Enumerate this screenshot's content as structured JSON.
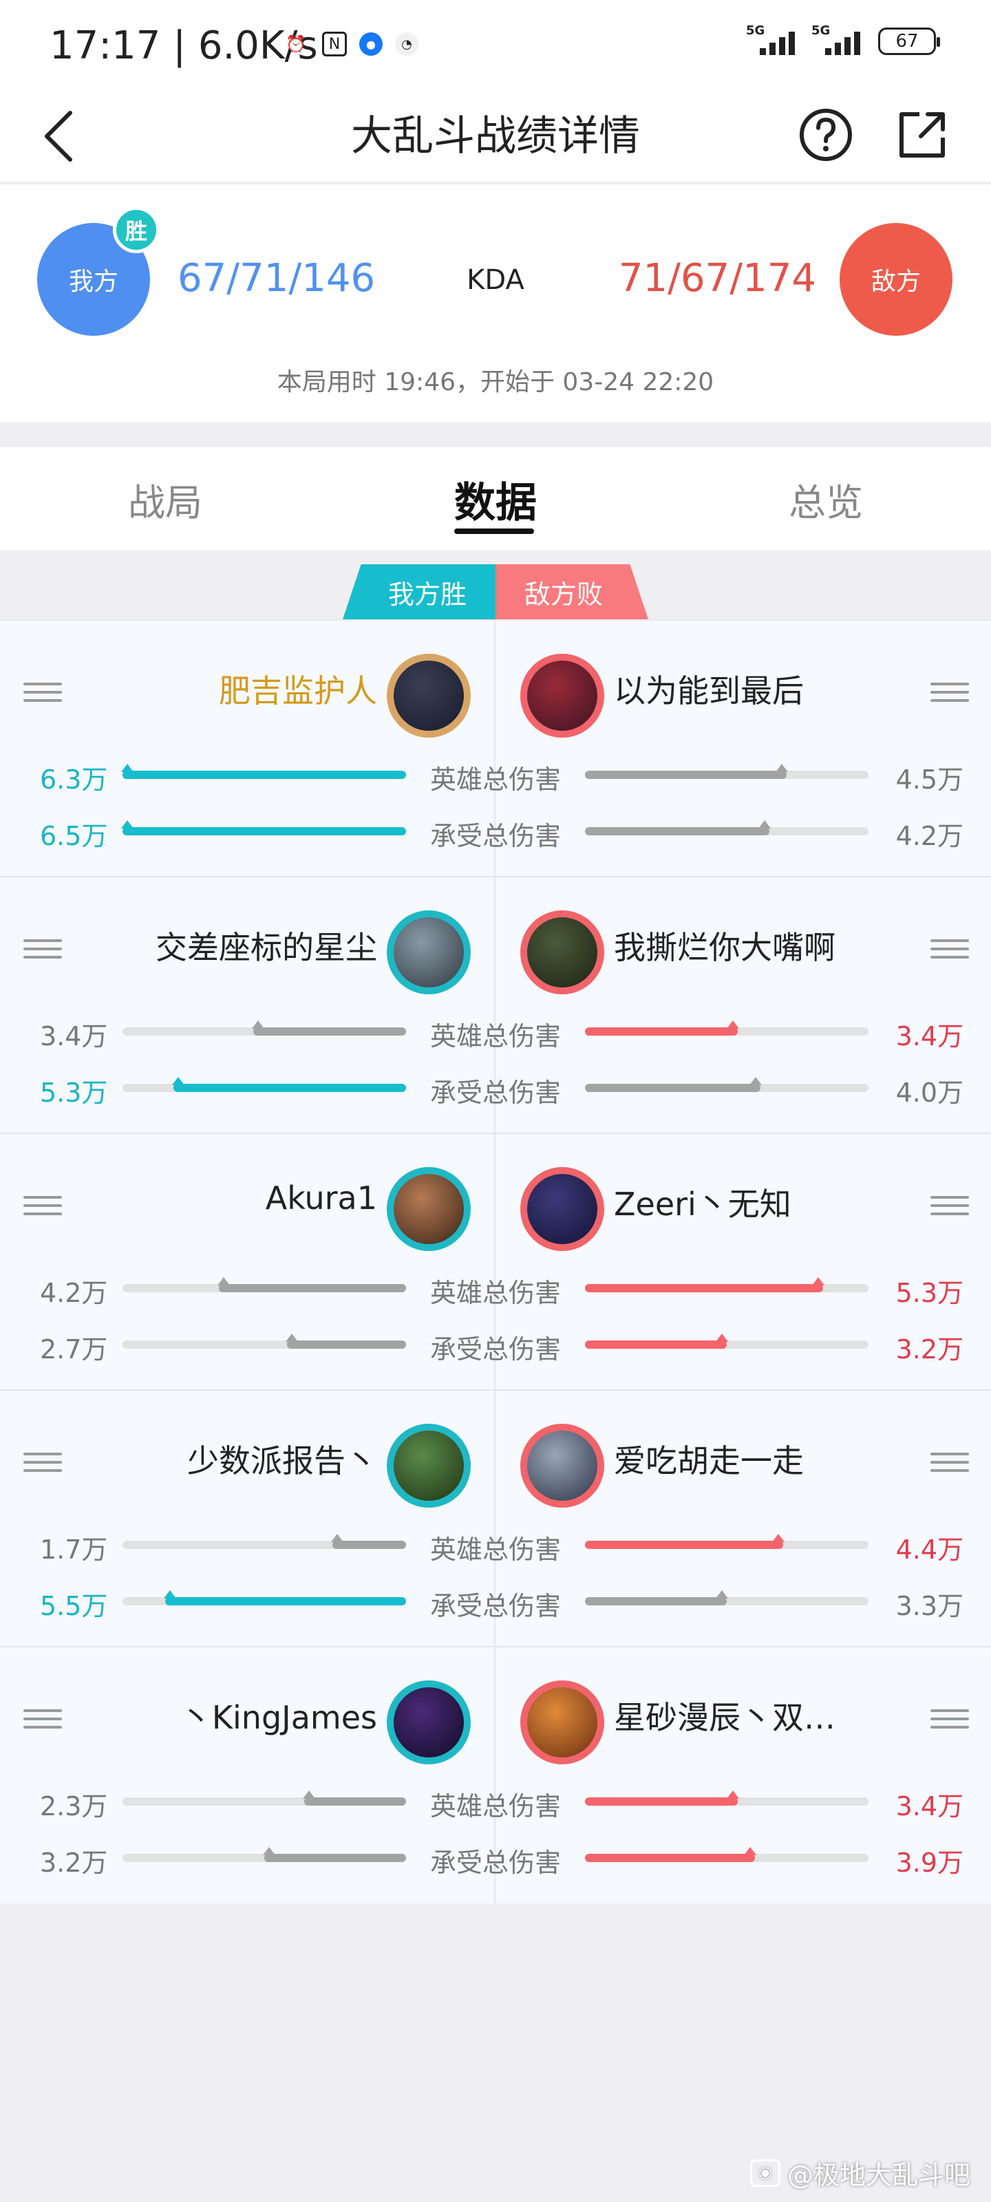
{
  "status": {
    "time": "17:17",
    "speed": "6.0K/s",
    "network1": "5G",
    "network2": "5G",
    "battery": "67"
  },
  "header": {
    "title": "大乱斗战绩详情"
  },
  "summary": {
    "left_team": "我方",
    "right_team": "敌方",
    "win_badge": "胜",
    "left_kda": "67/71/146",
    "right_kda": "71/67/174",
    "kda_label": "KDA",
    "time_info": "本局用时 19:46，开始于 03-24 22:20"
  },
  "tabs": [
    "战局",
    "数据",
    "总览"
  ],
  "active_tab": 1,
  "banner": {
    "left": "我方胜",
    "right": "敌方败"
  },
  "stat_labels": {
    "damage": "英雄总伤害",
    "taken": "承受总伤害"
  },
  "colors": {
    "teal": "#17bdcc",
    "gray": "#a3a3a3",
    "red": "#f4646c",
    "gold": "#d39a1c"
  },
  "players": [
    {
      "left": {
        "name": "肥吉监护人",
        "avatar": "dark-hero",
        "damage": "6.3万",
        "damage_fill": 1.0,
        "damage_style": "teal",
        "taken": "6.5万",
        "taken_fill": 1.0,
        "taken_style": "teal",
        "highlight": true
      },
      "right": {
        "name": "以为能到最后",
        "avatar": "red-haired-hero",
        "damage": "4.5万",
        "damage_fill": 0.71,
        "damage_style": "gray",
        "taken": "4.2万",
        "taken_fill": 0.65,
        "taken_style": "gray"
      }
    },
    {
      "left": {
        "name": "交差座标的星尘",
        "avatar": "armored-warrior",
        "damage": "3.4万",
        "damage_fill": 0.54,
        "damage_style": "gray",
        "taken": "5.3万",
        "taken_fill": 0.82,
        "taken_style": "teal"
      },
      "right": {
        "name": "我撕烂你大嘴啊",
        "avatar": "green-hooded-hero",
        "damage": "3.4万",
        "damage_fill": 0.54,
        "damage_style": "red",
        "taken": "4.0万",
        "taken_fill": 0.62,
        "taken_style": "gray"
      }
    },
    {
      "left": {
        "name": "Akura1",
        "avatar": "male-fighter",
        "damage": "4.2万",
        "damage_fill": 0.66,
        "damage_style": "gray",
        "taken": "2.7万",
        "taken_fill": 0.42,
        "taken_style": "gray"
      },
      "right": {
        "name": "Zeeri丶无知",
        "avatar": "yordle-mage",
        "damage": "5.3万",
        "damage_fill": 0.84,
        "damage_style": "red",
        "taken": "3.2万",
        "taken_fill": 0.5,
        "taken_style": "red"
      }
    },
    {
      "left": {
        "name": "少数派报告丶",
        "avatar": "green-beast",
        "damage": "1.7万",
        "damage_fill": 0.26,
        "damage_style": "gray",
        "taken": "5.5万",
        "taken_fill": 0.85,
        "taken_style": "teal"
      },
      "right": {
        "name": "爱吃胡走一走",
        "avatar": "silver-armored-hero",
        "damage": "4.4万",
        "damage_fill": 0.7,
        "damage_style": "red",
        "taken": "3.3万",
        "taken_fill": 0.5,
        "taken_style": "gray"
      }
    },
    {
      "left": {
        "name": "丶KingJames",
        "avatar": "void-creature",
        "damage": "2.3万",
        "damage_fill": 0.36,
        "damage_style": "gray",
        "taken": "3.2万",
        "taken_fill": 0.5,
        "taken_style": "gray"
      },
      "right": {
        "name": "星砂漫辰丶双…",
        "avatar": "orange-yordle",
        "damage": "3.4万",
        "damage_fill": 0.54,
        "damage_style": "red",
        "taken": "3.9万",
        "taken_fill": 0.6,
        "taken_style": "red"
      }
    }
  ],
  "watermark": "@极地大乱斗吧"
}
